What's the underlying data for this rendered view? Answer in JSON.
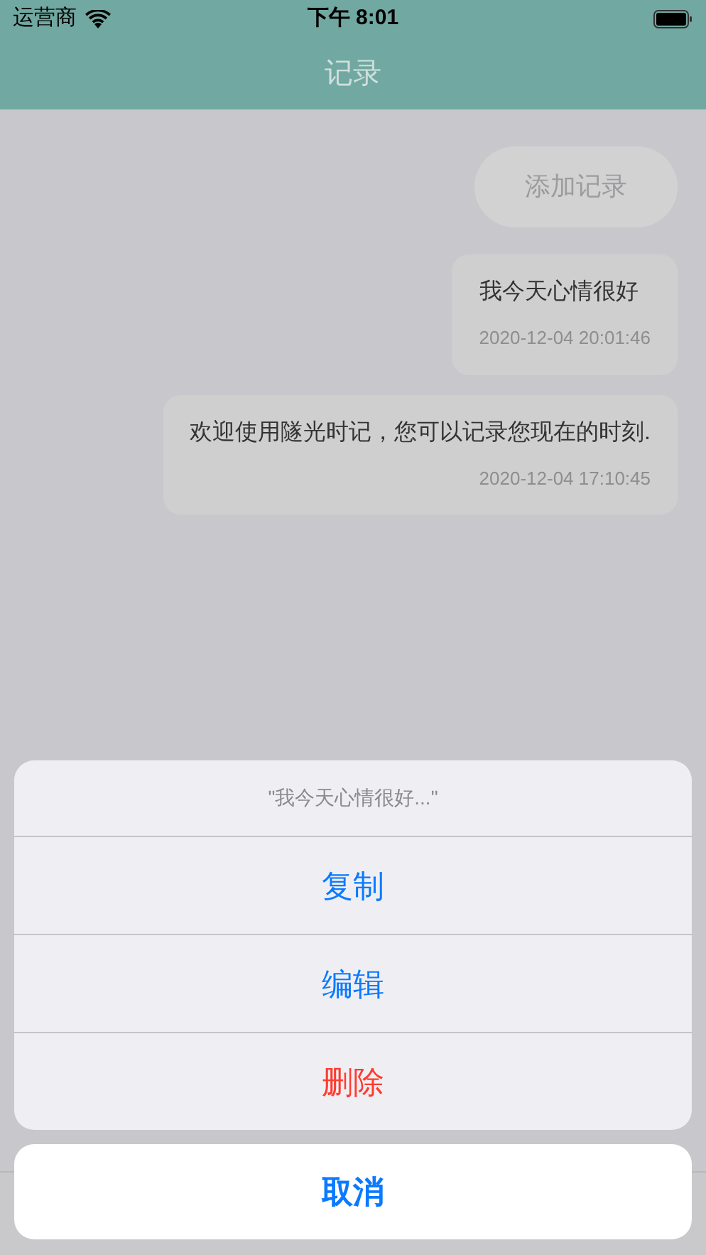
{
  "status_bar": {
    "carrier": "运营商",
    "time": "下午 8:01"
  },
  "nav_bar": {
    "title": "记录"
  },
  "add_button": "添加记录",
  "records": [
    {
      "text": "我今天心情很好",
      "time": "2020-12-04 20:01:46"
    },
    {
      "text": "欢迎使用隧光时记，您可以记录您现在的时刻.",
      "time": "2020-12-04 17:10:45"
    }
  ],
  "action_sheet": {
    "title": "\"我今天心情很好...\"",
    "actions": [
      {
        "label": "复制",
        "kind": "default"
      },
      {
        "label": "编辑",
        "kind": "default"
      },
      {
        "label": "删除",
        "kind": "destructive"
      }
    ],
    "cancel": "取消"
  }
}
